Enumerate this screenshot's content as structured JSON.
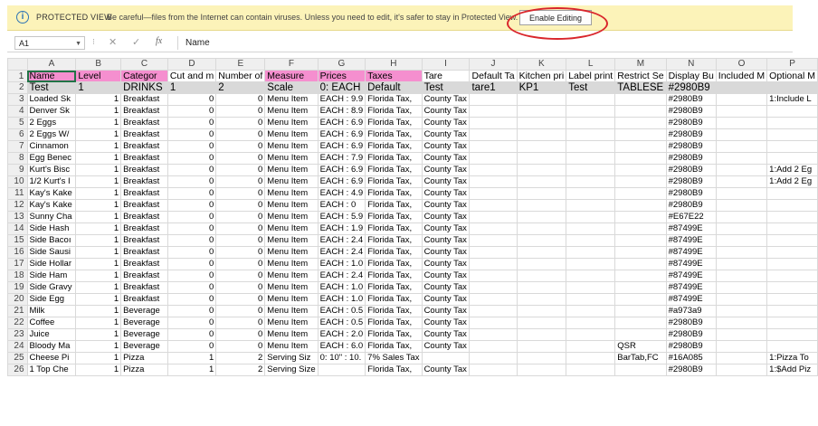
{
  "protected_view": {
    "title": "PROTECTED VIEW",
    "message": "Be careful—files from the Internet can contain viruses. Unless you need to edit, it's safer to stay in Protected View.",
    "enable_label": "Enable Editing"
  },
  "formula_bar": {
    "cell_ref": "A1",
    "content": "Name"
  },
  "columns": [
    "A",
    "B",
    "C",
    "D",
    "E",
    "F",
    "G",
    "H",
    "I",
    "J",
    "K",
    "L",
    "M",
    "N",
    "O",
    "P"
  ],
  "header_row": [
    "Name",
    "Level",
    "Categor",
    "Cut and m",
    "Number of",
    "Measure",
    "Prices",
    "Taxes",
    "Tare",
    "Default Ta",
    "Kitchen pri",
    "Label print",
    "Restrict Se",
    "Display Bu",
    "Included M",
    "Optional M"
  ],
  "pink_headers": [
    0,
    1,
    2,
    5,
    6,
    7
  ],
  "row2": [
    "Test",
    "1",
    "DRINKS",
    "1",
    "2",
    "Scale",
    "0: EACH",
    "Default",
    "Test",
    "tare1",
    "KP1",
    "Test",
    "TABLESE",
    "#2980B9",
    "",
    ""
  ],
  "rows": [
    [
      "Loaded Sk",
      "1",
      "Breakfast",
      "0",
      "0",
      "Menu Item",
      "EACH : 9.9",
      "Florida Tax,",
      "County Tax",
      "",
      "",
      "",
      "",
      "#2980B9",
      "",
      "1:Include L"
    ],
    [
      "Denver Sk",
      "1",
      "Breakfast",
      "0",
      "0",
      "Menu Item",
      "EACH : 8.9",
      "Florida Tax,",
      "County Tax",
      "",
      "",
      "",
      "",
      "#2980B9",
      "",
      ""
    ],
    [
      "2 Eggs",
      "1",
      "Breakfast",
      "0",
      "0",
      "Menu Item",
      "EACH : 6.9",
      "Florida Tax,",
      "County Tax",
      "",
      "",
      "",
      "",
      "#2980B9",
      "",
      ""
    ],
    [
      "2 Eggs W/",
      "1",
      "Breakfast",
      "0",
      "0",
      "Menu Item",
      "EACH : 6.9",
      "Florida Tax,",
      "County Tax",
      "",
      "",
      "",
      "",
      "#2980B9",
      "",
      ""
    ],
    [
      "Cinnamon",
      "1",
      "Breakfast",
      "0",
      "0",
      "Menu Item",
      "EACH : 6.9",
      "Florida Tax,",
      "County Tax",
      "",
      "",
      "",
      "",
      "#2980B9",
      "",
      ""
    ],
    [
      "Egg Benec",
      "1",
      "Breakfast",
      "0",
      "0",
      "Menu Item",
      "EACH : 7.9",
      "Florida Tax,",
      "County Tax",
      "",
      "",
      "",
      "",
      "#2980B9",
      "",
      ""
    ],
    [
      "Kurt's Bisc",
      "1",
      "Breakfast",
      "0",
      "0",
      "Menu Item",
      "EACH : 6.9",
      "Florida Tax,",
      "County Tax",
      "",
      "",
      "",
      "",
      "#2980B9",
      "",
      "1:Add 2 Eg"
    ],
    [
      "1/2 Kurt's I",
      "1",
      "Breakfast",
      "0",
      "0",
      "Menu Item",
      "EACH : 6.9",
      "Florida Tax,",
      "County Tax",
      "",
      "",
      "",
      "",
      "#2980B9",
      "",
      "1:Add 2 Eg"
    ],
    [
      "Kay's Kake",
      "1",
      "Breakfast",
      "0",
      "0",
      "Menu Item",
      "EACH : 4.9",
      "Florida Tax,",
      "County Tax",
      "",
      "",
      "",
      "",
      "#2980B9",
      "",
      ""
    ],
    [
      "Kay's Kake",
      "1",
      "Breakfast",
      "0",
      "0",
      "Menu Item",
      "EACH : 0",
      "Florida Tax,",
      "County Tax",
      "",
      "",
      "",
      "",
      "#2980B9",
      "",
      ""
    ],
    [
      "Sunny Cha",
      "1",
      "Breakfast",
      "0",
      "0",
      "Menu Item",
      "EACH : 5.9",
      "Florida Tax,",
      "County Tax",
      "",
      "",
      "",
      "",
      "#E67E22",
      "",
      ""
    ],
    [
      "Side Hash",
      "1",
      "Breakfast",
      "0",
      "0",
      "Menu Item",
      "EACH : 1.9",
      "Florida Tax,",
      "County Tax",
      "",
      "",
      "",
      "",
      "#87499E",
      "",
      ""
    ],
    [
      "Side Bacoı",
      "1",
      "Breakfast",
      "0",
      "0",
      "Menu Item",
      "EACH : 2.4",
      "Florida Tax,",
      "County Tax",
      "",
      "",
      "",
      "",
      "#87499E",
      "",
      ""
    ],
    [
      "Side Sausi",
      "1",
      "Breakfast",
      "0",
      "0",
      "Menu Item",
      "EACH : 2.4",
      "Florida Tax,",
      "County Tax",
      "",
      "",
      "",
      "",
      "#87499E",
      "",
      ""
    ],
    [
      "Side Hollar",
      "1",
      "Breakfast",
      "0",
      "0",
      "Menu Item",
      "EACH : 1.0",
      "Florida Tax,",
      "County Tax",
      "",
      "",
      "",
      "",
      "#87499E",
      "",
      ""
    ],
    [
      "Side Ham",
      "1",
      "Breakfast",
      "0",
      "0",
      "Menu Item",
      "EACH : 2.4",
      "Florida Tax,",
      "County Tax",
      "",
      "",
      "",
      "",
      "#87499E",
      "",
      ""
    ],
    [
      "Side Gravy",
      "1",
      "Breakfast",
      "0",
      "0",
      "Menu Item",
      "EACH : 1.0",
      "Florida Tax,",
      "County Tax",
      "",
      "",
      "",
      "",
      "#87499E",
      "",
      ""
    ],
    [
      "Side Egg",
      "1",
      "Breakfast",
      "0",
      "0",
      "Menu Item",
      "EACH : 1.0",
      "Florida Tax,",
      "County Tax",
      "",
      "",
      "",
      "",
      "#87499E",
      "",
      ""
    ],
    [
      "Milk",
      "1",
      "Beverage",
      "0",
      "0",
      "Menu Item",
      "EACH : 0.5",
      "Florida Tax,",
      "County Tax",
      "",
      "",
      "",
      "",
      "#a973a9",
      "",
      ""
    ],
    [
      "Coffee",
      "1",
      "Beverage",
      "0",
      "0",
      "Menu Item",
      "EACH : 0.5",
      "Florida Tax,",
      "County Tax",
      "",
      "",
      "",
      "",
      "#2980B9",
      "",
      ""
    ],
    [
      "Juice",
      "1",
      "Beverage",
      "0",
      "0",
      "Menu Item",
      "EACH : 2.0",
      "Florida Tax,",
      "County Tax",
      "",
      "",
      "",
      "",
      "#2980B9",
      "",
      ""
    ],
    [
      "Bloody Ma",
      "1",
      "Beverage",
      "0",
      "0",
      "Menu Item",
      "EACH : 6.0",
      "Florida Tax,",
      "County Tax",
      "",
      "",
      "",
      "QSR",
      "#2980B9",
      "",
      ""
    ],
    [
      "Cheese Pi",
      "1",
      "Pizza",
      "1",
      "2",
      "Serving Siz",
      "0: 10\" : 10.",
      "7% Sales Tax",
      "",
      "",
      "",
      "",
      "BarTab,FC",
      "#16A085",
      "",
      "1:Pizza To"
    ],
    [
      "1 Top Che",
      "1",
      "Pizza",
      "1",
      "2",
      "Serving Size",
      "",
      "Florida Tax,",
      "County Tax",
      "",
      "",
      "",
      "",
      "#2980B9",
      "",
      "1:$Add Piz"
    ]
  ]
}
